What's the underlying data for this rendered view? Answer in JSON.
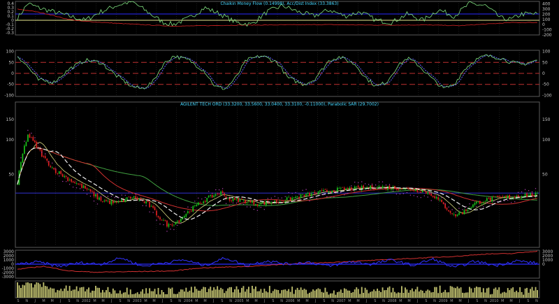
{
  "colors": {
    "background": "#000000",
    "panel_border": "#5a5a5a",
    "grid": "#3a3a3a",
    "title": "#44d7ff",
    "axis_text": "#c8c8c8",
    "cmf": "#7fe07f",
    "acc_dist": "#c02020",
    "blue_ref": "#2a2aff",
    "yellow_zero": "#e8e890",
    "stoch_k": "#7fe07f",
    "stoch_d": "#6060ff",
    "stoch_levels": "#c03030",
    "candle_up": "#19c219",
    "candle_down": "#e02020",
    "ma_white": "#f0f0f0",
    "ma_red": "#d03030",
    "ma_green": "#40a040",
    "ma_yellow": "#d8d880",
    "sar": "#b040b0",
    "hline": "#3030d0",
    "vol_osc": "#3232ff",
    "obv": "#d03030",
    "volume": "#b8b86a"
  },
  "chart_data": [
    {
      "type": "line",
      "title": "Chaikin Money Flow (0.14998), Acc/Dist Index (33.3863)",
      "left_ticks": [
        "0.4",
        "0.3",
        "0.2",
        "0.1",
        "0",
        "-0.1",
        "-0.2",
        "-0.3"
      ],
      "left_range": [
        -0.35,
        0.45
      ],
      "right_ticks": [
        "400",
        "300",
        "200",
        "100",
        "0",
        "-100",
        "-200"
      ],
      "right_range": [
        -200,
        450
      ],
      "cmf_knots": [
        [
          0,
          0.05
        ],
        [
          0.02,
          0.4
        ],
        [
          0.04,
          0.3
        ],
        [
          0.07,
          0.2
        ],
        [
          0.1,
          0.1
        ],
        [
          0.13,
          0.0
        ],
        [
          0.16,
          0.2
        ],
        [
          0.19,
          0.35
        ],
        [
          0.22,
          0.45
        ],
        [
          0.25,
          0.2
        ],
        [
          0.28,
          -0.05
        ],
        [
          0.3,
          -0.1
        ],
        [
          0.33,
          0.05
        ],
        [
          0.36,
          0.3
        ],
        [
          0.39,
          0.15
        ],
        [
          0.42,
          -0.05
        ],
        [
          0.45,
          -0.1
        ],
        [
          0.48,
          0.2
        ],
        [
          0.51,
          0.35
        ],
        [
          0.54,
          0.2
        ],
        [
          0.57,
          0.1
        ],
        [
          0.6,
          0.25
        ],
        [
          0.63,
          0.1
        ],
        [
          0.66,
          0.2
        ],
        [
          0.69,
          0.0
        ],
        [
          0.72,
          -0.05
        ],
        [
          0.75,
          0.15
        ],
        [
          0.78,
          0.0
        ],
        [
          0.81,
          0.25
        ],
        [
          0.84,
          0.1
        ],
        [
          0.87,
          0.4
        ],
        [
          0.9,
          0.35
        ],
        [
          0.93,
          0.05
        ],
        [
          0.95,
          0.02
        ],
        [
          0.97,
          0.15
        ],
        [
          1.0,
          0.15
        ]
      ],
      "acc_knots": [
        [
          0,
          300
        ],
        [
          0.03,
          260
        ],
        [
          0.06,
          200
        ],
        [
          0.09,
          120
        ],
        [
          0.12,
          70
        ],
        [
          0.2,
          20
        ],
        [
          0.3,
          -30
        ],
        [
          0.36,
          -20
        ],
        [
          0.42,
          -10
        ],
        [
          0.5,
          -5
        ],
        [
          0.6,
          0
        ],
        [
          0.7,
          -10
        ],
        [
          0.78,
          -5
        ],
        [
          0.85,
          -20
        ],
        [
          0.9,
          10
        ],
        [
          0.95,
          40
        ],
        [
          1.0,
          40
        ]
      ],
      "blue_level": 0.14998,
      "yellow_level": 0
    },
    {
      "type": "line",
      "title": "",
      "left_ticks": [
        "100",
        "50",
        "0",
        "-50",
        "-100"
      ],
      "left_range": [
        -105,
        105
      ],
      "right_ticks": [
        "100",
        "50",
        "0",
        "-50",
        "-100"
      ],
      "right_range": [
        -105,
        105
      ],
      "level_lines": [
        50,
        0,
        -50
      ],
      "osc_knots": [
        [
          0,
          80
        ],
        [
          0.02,
          30
        ],
        [
          0.04,
          -30
        ],
        [
          0.07,
          -40
        ],
        [
          0.1,
          20
        ],
        [
          0.13,
          60
        ],
        [
          0.16,
          50
        ],
        [
          0.19,
          -10
        ],
        [
          0.22,
          -60
        ],
        [
          0.24,
          -70
        ],
        [
          0.26,
          -40
        ],
        [
          0.28,
          40
        ],
        [
          0.3,
          80
        ],
        [
          0.33,
          60
        ],
        [
          0.36,
          10
        ],
        [
          0.38,
          -60
        ],
        [
          0.4,
          -70
        ],
        [
          0.42,
          -20
        ],
        [
          0.44,
          60
        ],
        [
          0.47,
          80
        ],
        [
          0.5,
          50
        ],
        [
          0.52,
          -20
        ],
        [
          0.55,
          -50
        ],
        [
          0.57,
          -30
        ],
        [
          0.6,
          60
        ],
        [
          0.62,
          75
        ],
        [
          0.65,
          40
        ],
        [
          0.67,
          -20
        ],
        [
          0.69,
          -60
        ],
        [
          0.71,
          -40
        ],
        [
          0.73,
          30
        ],
        [
          0.75,
          70
        ],
        [
          0.77,
          40
        ],
        [
          0.8,
          -30
        ],
        [
          0.82,
          -70
        ],
        [
          0.84,
          -50
        ],
        [
          0.86,
          20
        ],
        [
          0.88,
          60
        ],
        [
          0.9,
          80
        ],
        [
          0.93,
          70
        ],
        [
          0.95,
          50
        ],
        [
          0.97,
          40
        ],
        [
          1.0,
          60
        ]
      ]
    },
    {
      "type": "candlestick",
      "title": "AGILENT TECH ORD (33.3200, 33.5600, 33.0400, 33.3100, -0.11000), Parabolic SAR (29.7002)",
      "left_ticks": [
        "150",
        "100",
        "50"
      ],
      "right_ticks": [
        "150",
        "100",
        "50"
      ],
      "log_scale": true,
      "ylim": [
        12,
        190
      ],
      "close_knots": [
        [
          0,
          40
        ],
        [
          0.02,
          110
        ],
        [
          0.035,
          90
        ],
        [
          0.05,
          70
        ],
        [
          0.07,
          55
        ],
        [
          0.1,
          45
        ],
        [
          0.13,
          38
        ],
        [
          0.16,
          30
        ],
        [
          0.19,
          28
        ],
        [
          0.22,
          32
        ],
        [
          0.25,
          28
        ],
        [
          0.27,
          22
        ],
        [
          0.29,
          18
        ],
        [
          0.31,
          20
        ],
        [
          0.33,
          24
        ],
        [
          0.36,
          30
        ],
        [
          0.39,
          35
        ],
        [
          0.41,
          30
        ],
        [
          0.43,
          30
        ],
        [
          0.46,
          28
        ],
        [
          0.5,
          29
        ],
        [
          0.54,
          32
        ],
        [
          0.58,
          35
        ],
        [
          0.62,
          37
        ],
        [
          0.66,
          38
        ],
        [
          0.7,
          39
        ],
        [
          0.74,
          38
        ],
        [
          0.78,
          36
        ],
        [
          0.8,
          33
        ],
        [
          0.82,
          27
        ],
        [
          0.84,
          22
        ],
        [
          0.86,
          24
        ],
        [
          0.88,
          28
        ],
        [
          0.9,
          30
        ],
        [
          0.92,
          31
        ],
        [
          0.95,
          32
        ],
        [
          0.975,
          33.31
        ],
        [
          1.0,
          33.31
        ]
      ],
      "hline_level": 34.5
    },
    {
      "type": "line",
      "title": "",
      "left_ticks": [
        "3000",
        "2000",
        "1000",
        "0",
        "-1000",
        "-2000",
        "-3000"
      ],
      "left_range": [
        -3300,
        3300
      ],
      "right_ticks": [
        "3000",
        "2000",
        "1000",
        "0"
      ],
      "right_range": [
        -3300,
        3300
      ],
      "level_lines": [
        0
      ],
      "vol_osc_knots": [
        [
          0,
          0
        ],
        [
          0.04,
          500
        ],
        [
          0.08,
          -500
        ],
        [
          0.12,
          300
        ],
        [
          0.16,
          0
        ],
        [
          0.2,
          1500
        ],
        [
          0.24,
          -500
        ],
        [
          0.28,
          300
        ],
        [
          0.32,
          1000
        ],
        [
          0.36,
          -300
        ],
        [
          0.4,
          1500
        ],
        [
          0.44,
          -300
        ],
        [
          0.48,
          800
        ],
        [
          0.52,
          0
        ],
        [
          0.56,
          500
        ],
        [
          0.6,
          -500
        ],
        [
          0.64,
          600
        ],
        [
          0.68,
          0
        ],
        [
          0.72,
          1000
        ],
        [
          0.76,
          -300
        ],
        [
          0.8,
          1200
        ],
        [
          0.84,
          -800
        ],
        [
          0.88,
          700
        ],
        [
          0.92,
          -300
        ],
        [
          0.96,
          800
        ],
        [
          1.0,
          200
        ]
      ],
      "obv_knots": [
        [
          0,
          -1200
        ],
        [
          0.05,
          -500
        ],
        [
          0.1,
          -1600
        ],
        [
          0.15,
          -1900
        ],
        [
          0.2,
          -1800
        ],
        [
          0.25,
          -1700
        ],
        [
          0.3,
          -1600
        ],
        [
          0.35,
          -900
        ],
        [
          0.4,
          -700
        ],
        [
          0.45,
          -500
        ],
        [
          0.5,
          -100
        ],
        [
          0.55,
          200
        ],
        [
          0.6,
          400
        ],
        [
          0.65,
          700
        ],
        [
          0.7,
          1000
        ],
        [
          0.75,
          1300
        ],
        [
          0.8,
          1600
        ],
        [
          0.85,
          1900
        ],
        [
          0.9,
          2400
        ],
        [
          0.95,
          2500
        ],
        [
          1.0,
          3100
        ]
      ]
    },
    {
      "type": "bar",
      "title": "",
      "left_ticks": [],
      "right_ticks": []
    }
  ],
  "x_axis": {
    "date_labels": [
      "S",
      "N",
      "J",
      "M",
      "M",
      "J",
      "S",
      "N",
      "2002",
      "M",
      "M",
      "J",
      "S",
      "N",
      "2003",
      "M",
      "M",
      "J",
      "S",
      "N",
      "2004",
      "M",
      "M",
      "J",
      "S",
      "N",
      "2005",
      "M",
      "M",
      "J",
      "S",
      "N",
      "2006",
      "M",
      "M",
      "J",
      "S",
      "N",
      "2007",
      "M",
      "M",
      "J",
      "S",
      "N",
      "2008",
      "M",
      "M",
      "J",
      "S",
      "N",
      "2009",
      "M",
      "M",
      "J",
      "S",
      "N",
      "2010",
      "M",
      "M",
      "J",
      "S",
      "N"
    ]
  }
}
